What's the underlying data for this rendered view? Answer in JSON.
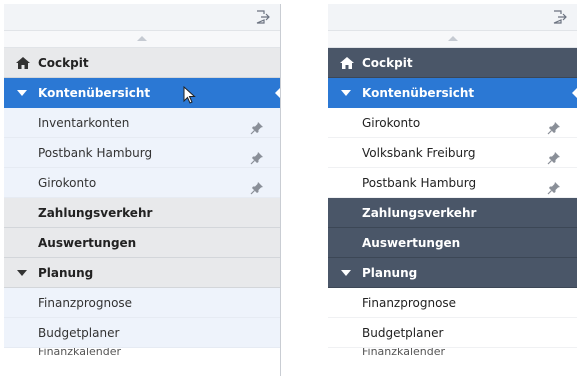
{
  "left_panel": {
    "nav": {
      "cockpit": "Cockpit",
      "kontenuebersicht": "Kontenübersicht",
      "accounts": [
        "Inventarkonten",
        "Postbank Hamburg",
        "Girokonto"
      ],
      "zahlungsverkehr": "Zahlungsverkehr",
      "auswertungen": "Auswertungen",
      "planung": "Planung",
      "planung_items": [
        "Finanzprognose",
        "Budgetplaner"
      ],
      "partial_bottom": "Finanzkalender"
    }
  },
  "right_panel": {
    "nav": {
      "cockpit": "Cockpit",
      "kontenuebersicht": "Kontenübersicht",
      "accounts": [
        "Girokonto",
        "Volksbank Freiburg",
        "Postbank Hamburg"
      ],
      "zahlungsverkehr": "Zahlungsverkehr",
      "auswertungen": "Auswertungen",
      "planung": "Planung",
      "planung_items": [
        "Finanzprognose",
        "Budgetplaner"
      ],
      "partial_bottom": "Finanzkalender"
    }
  },
  "colors": {
    "accent_blue": "#2b78d4",
    "dark_section": "#4a5668",
    "light_section": "#e8e9eb"
  },
  "icons": [
    "exit-icon",
    "home-icon",
    "triangle-down-icon",
    "pin-icon",
    "mouse-pointer-icon"
  ]
}
